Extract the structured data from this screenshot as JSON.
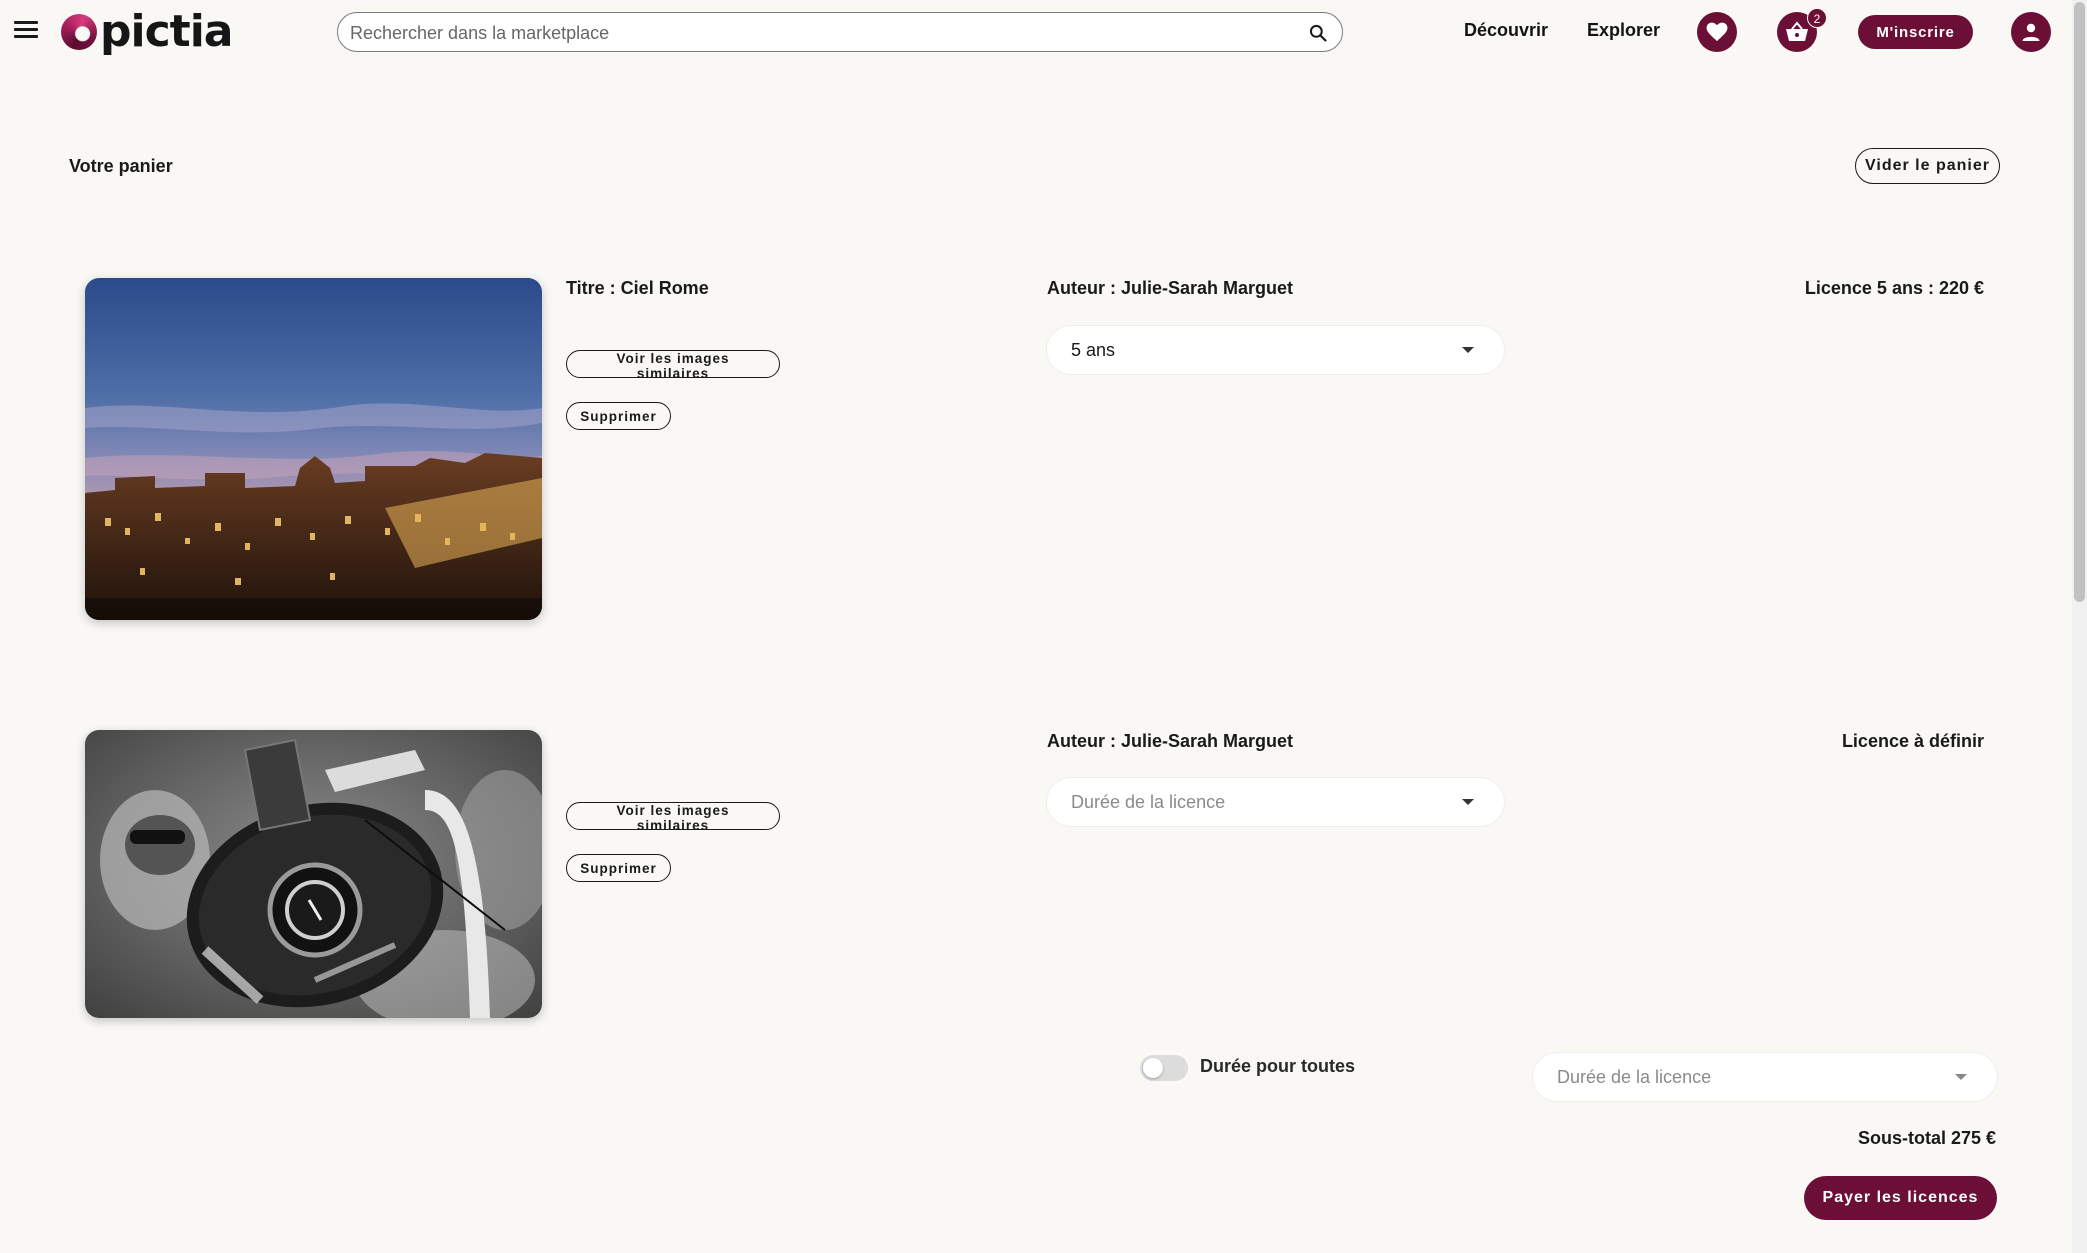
{
  "header": {
    "logo_text": "pictia",
    "search_placeholder": "Rechercher dans la marketplace",
    "nav": [
      "Découvrir",
      "Explorer"
    ],
    "cart_count": "2",
    "register_label": "M'inscrire"
  },
  "cart": {
    "title": "Votre panier",
    "empty_label": "Vider le panier",
    "items": [
      {
        "title": "Titre : Ciel Rome",
        "similar_label": "Voir les images similaires",
        "delete_label": "Supprimer",
        "author": "Auteur : Julie-Sarah Marguet",
        "duration_value": "5 ans",
        "license_summary": "Licence 5 ans : 220 €"
      },
      {
        "title": "",
        "similar_label": "Voir les images similaires",
        "delete_label": "Supprimer",
        "author": "Auteur : Julie-Sarah Marguet",
        "duration_placeholder": "Durée de la licence",
        "license_summary": "Licence à définir"
      }
    ],
    "bulk": {
      "toggle_label": "Durée pour toutes",
      "toggle_on": false,
      "duration_placeholder": "Durée de la licence"
    },
    "subtotal": "Sous-total 275 €",
    "pay_label": "Payer les licences"
  },
  "colors": {
    "accent": "#6b0f37",
    "background": "#f9f8f5"
  }
}
